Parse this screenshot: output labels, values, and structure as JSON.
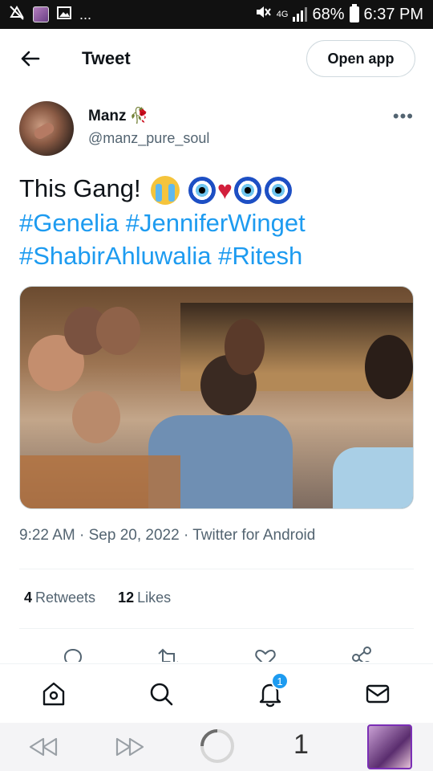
{
  "statusbar": {
    "network": "4G",
    "battery": "68%",
    "time": "6:37 PM",
    "more": "..."
  },
  "header": {
    "title": "Tweet",
    "open_app": "Open app"
  },
  "author": {
    "name": "Manz",
    "name_emoji": "🥀",
    "handle": "@manz_pure_soul"
  },
  "tweet": {
    "text": "This Gang!",
    "hashtags": [
      "#Genelia",
      "#JenniferWinget",
      "#ShabirAhluwalia",
      "#Ritesh"
    ]
  },
  "meta": {
    "time": "9:22 AM",
    "date": "Sep 20, 2022",
    "source": "Twitter for Android",
    "separator": "·"
  },
  "stats": {
    "retweets_count": "4",
    "retweets_label": "Retweets",
    "likes_count": "12",
    "likes_label": "Likes"
  },
  "tabbar": {
    "notifications_badge": "1"
  },
  "browser": {
    "tab_count": "1"
  },
  "colors": {
    "accent": "#1d9bf0",
    "text": "#0f1419",
    "muted": "#536471"
  }
}
